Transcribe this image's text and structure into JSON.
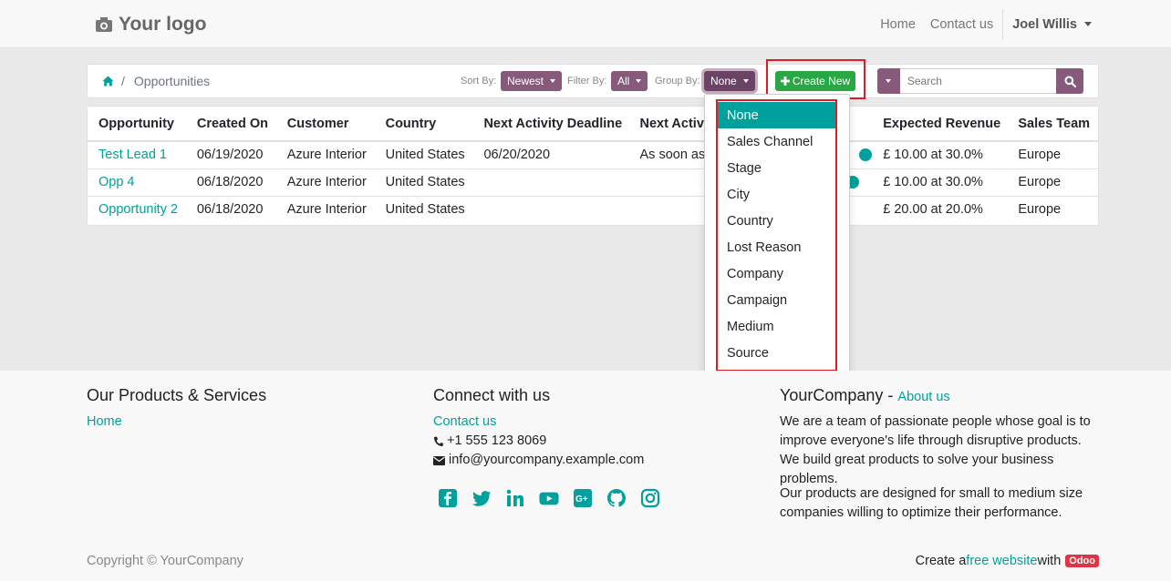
{
  "header": {
    "logo_text": "Your logo",
    "nav": [
      "Home",
      "Contact us"
    ],
    "user_name": "Joel Willis"
  },
  "toolbar": {
    "breadcrumb": "Opportunities",
    "sort_label": "Sort By:",
    "sort_value": "Newest",
    "filter_label": "Filter By:",
    "filter_value": "All",
    "group_label": "Group By:",
    "group_value": "None",
    "create_label": "Create New",
    "search_placeholder": "Search"
  },
  "table": {
    "columns": [
      "Opportunity",
      "Created On",
      "Customer",
      "Country",
      "Next Activity Deadline",
      "Next Activi",
      "Expected Revenue",
      "Sales Team"
    ],
    "rows": [
      {
        "opportunity": "Test Lead 1",
        "created_on": "06/19/2020",
        "customer": "Azure Interior",
        "country": "United States",
        "deadline": "06/20/2020",
        "next_activity": "As soon as",
        "revenue": "£ 10.00 at 30.0%",
        "team": "Europe"
      },
      {
        "opportunity": "Opp 4",
        "created_on": "06/18/2020",
        "customer": "Azure Interior",
        "country": "United States",
        "deadline": "",
        "next_activity": "",
        "revenue": "£ 10.00 at 30.0%",
        "team": "Europe"
      },
      {
        "opportunity": "Opportunity 2",
        "created_on": "06/18/2020",
        "customer": "Azure Interior",
        "country": "United States",
        "deadline": "",
        "next_activity": "",
        "revenue": "£ 20.00 at 20.0%",
        "team": "Europe"
      }
    ]
  },
  "group_by_menu": {
    "items": [
      "None",
      "Sales Channel",
      "Stage",
      "City",
      "Country",
      "Lost Reason",
      "Company",
      "Campaign",
      "Medium",
      "Source"
    ],
    "selected": "None"
  },
  "footer": {
    "products_heading": "Our Products & Services",
    "products_link": "Home",
    "connect_heading": "Connect with us",
    "contact_link": "Contact us",
    "phone": "+1 555 123 8069",
    "email": "info@yourcompany.example.com",
    "social_icons": [
      "facebook-icon",
      "twitter-icon",
      "linkedin-icon",
      "youtube-icon",
      "google-plus-icon",
      "github-icon",
      "instagram-icon"
    ],
    "company_name": "YourCompany",
    "company_dash": " - ",
    "about_link": "About us",
    "about_p1": "We are a team of passionate people whose goal is to improve everyone's life through disruptive products. We build great products to solve your business problems.",
    "about_p2": "Our products are designed for small to medium size companies willing to optimize their performance.",
    "copyright": "Copyright © YourCompany",
    "credit_prefix": "Create a ",
    "credit_link": "free website",
    "credit_mid": " with ",
    "credit_badge": "Odoo"
  },
  "colors": {
    "accent_teal": "#00a09d",
    "brand_purple": "#875a7b",
    "create_green": "#28a745",
    "highlight_red": "#e01b24"
  }
}
